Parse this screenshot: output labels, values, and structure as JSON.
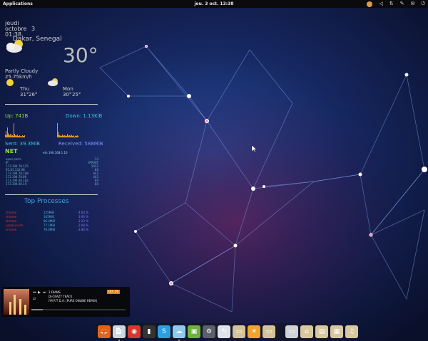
{
  "topbar": {
    "applications": "Applications",
    "clock": "jeu. 3 oct. 13:38"
  },
  "icons": {
    "tray": [
      "avatar-icon",
      "sound-icon",
      "network-icon",
      "pen-icon",
      "mail-icon",
      "power-icon"
    ]
  },
  "conky": {
    "day": "jeudi",
    "month": "octobre",
    "date_num": "3",
    "time": "01:38",
    "location": "Dakar, Senegal",
    "temperature": "30°",
    "condition": "Partly Cloudy",
    "wind": "25.75km/h",
    "forecast": [
      {
        "day": "Thu",
        "low": "31°",
        "high": "26°"
      },
      {
        "day": "Mon",
        "low": "30°",
        "high": "25°"
      }
    ],
    "up": "Up: 741B",
    "down": "Down: 1.13KiB",
    "sent": "Sent: 39.3MiB",
    "received": "Received: 588MiB",
    "net_label": "NET",
    "ip": "eth 190.168.1.10",
    "net_table": [
      [
        "open ports",
        "13"
      ],
      [
        "IP",
        "IPPORT"
      ],
      [
        "173.194.78.125",
        "5022"
      ],
      [
        "95.81.132.98",
        "80"
      ],
      [
        "173.194.78.188",
        "443"
      ],
      [
        "173.194.78.80",
        "443"
      ],
      [
        "173.194.40.182",
        "80"
      ],
      [
        "173.194.40.19",
        "80"
      ]
    ],
    "top_title": "Top Processes",
    "processes": [
      {
        "name": "chrome",
        "mem": "125MiB",
        "cpu": "4.63 %"
      },
      {
        "name": "chrome",
        "mem": "105MiB",
        "cpu": "3.93 %"
      },
      {
        "name": "chrome",
        "mem": "86.4MiB",
        "cpu": "3.23 %"
      },
      {
        "name": "nautilus-slm",
        "mem": "77.1MiB",
        "cpu": "2.68 %"
      },
      {
        "name": "chrome",
        "mem": "76.0MiB",
        "cpu": "2.84 %"
      }
    ]
  },
  "music": {
    "line1": "2 DIAMS",
    "line2": "DJ-CRAZY TRACK",
    "line3": "I'M R'T D.A. (PURE ONLINE REMIX)",
    "time": "00:36",
    "progress": 0.12
  },
  "dock": {
    "apps": [
      {
        "name": "firefox-icon",
        "glyph": "🦊",
        "color": "#e2641c"
      },
      {
        "name": "files-icon",
        "glyph": "📄",
        "color": "#cfd6df"
      },
      {
        "name": "chrome-icon",
        "glyph": "◉",
        "color": "#d8382c"
      },
      {
        "name": "terminal-icon",
        "glyph": "▮",
        "color": "#333333"
      },
      {
        "name": "skype-icon",
        "glyph": "S",
        "color": "#2aa0e0"
      },
      {
        "name": "cloud-icon",
        "glyph": "☁",
        "color": "#8fc9ee"
      },
      {
        "name": "android-icon",
        "glyph": "▣",
        "color": "#6fb23a"
      },
      {
        "name": "settings-icon",
        "glyph": "⚙",
        "color": "#5a5f6a"
      },
      {
        "name": "editor-icon",
        "glyph": "✎",
        "color": "#dfe4ea"
      },
      {
        "name": "folder-icon",
        "glyph": "▭",
        "color": "#d6c29a"
      },
      {
        "name": "sun-icon",
        "glyph": "☀",
        "color": "#f2a42a"
      },
      {
        "name": "folder-icon-2",
        "glyph": "▭",
        "color": "#d6c29a"
      },
      {
        "name": "display-icon",
        "glyph": "▭",
        "color": "#cfd2d6"
      },
      {
        "name": "folder-home-icon",
        "glyph": "⌂",
        "color": "#d9c7a0"
      },
      {
        "name": "folder-docs-icon",
        "glyph": "▤",
        "color": "#d9c7a0"
      },
      {
        "name": "folder-images-icon",
        "glyph": "▦",
        "color": "#d9c7a0"
      },
      {
        "name": "folder-music-icon",
        "glyph": "♫",
        "color": "#d9c7a0"
      }
    ]
  }
}
